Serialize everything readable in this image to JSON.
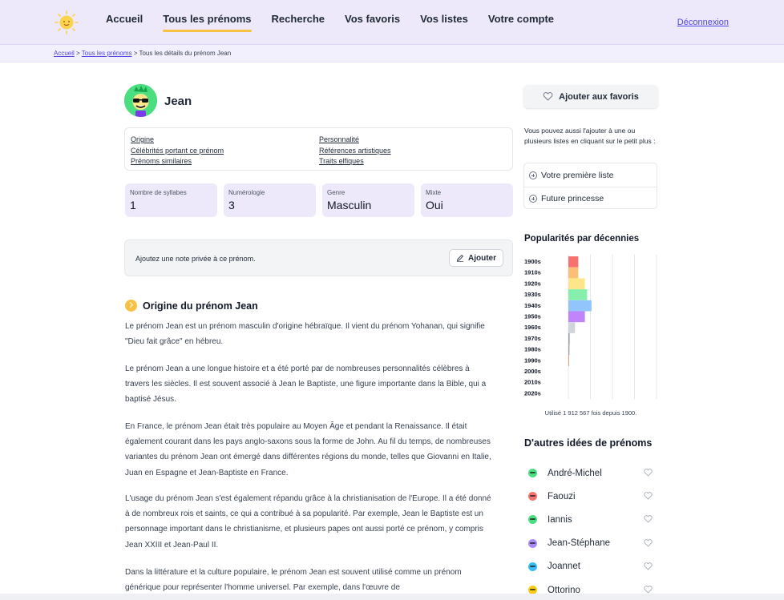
{
  "nav": {
    "items": [
      "Accueil",
      "Tous les prénoms",
      "Recherche",
      "Vos favoris",
      "Vos listes",
      "Votre compte"
    ],
    "active_index": 1,
    "logout": "Déconnexion",
    "logo_icon": "sun-icon"
  },
  "breadcrumb": {
    "home": "Accueil",
    "sep1": " > ",
    "all_names": "Tous les prénoms",
    "sep2": " > ",
    "current": "Tous les détails du prénom Jean"
  },
  "profile": {
    "name": "Jean",
    "avatar_icon": "sunglasses-avatar-icon",
    "avatar_color": "#4ade80"
  },
  "sections": {
    "left": [
      "Origine",
      "Célébrités portant ce prénom",
      "Prénoms similaires"
    ],
    "right": [
      "Personnalité",
      "Références artistiques",
      "Traits elfiques"
    ]
  },
  "stats": [
    {
      "label": "Nombre de syllabes",
      "value": "1"
    },
    {
      "label": "Numérologie",
      "value": "3"
    },
    {
      "label": "Genre",
      "value": "Masculin"
    },
    {
      "label": "Mixte",
      "value": "Oui"
    }
  ],
  "note": {
    "text": "Ajoutez une note privée à ce prénom.",
    "button": "Ajouter"
  },
  "origin": {
    "title": "Origine du prénom Jean",
    "paragraphs": [
      "Le prénom Jean est un prénom masculin d'origine hébraïque. Il vient du prénom Yohanan, qui signifie \"Dieu fait grâce\" en hébreu.",
      "Le prénom Jean a une longue histoire et a été porté par de nombreuses personnalités célèbres à travers les siècles. Il est souvent associé à Jean le Baptiste, une figure importante dans la Bible, qui a baptisé Jésus.",
      "En France, le prénom Jean était très populaire au Moyen Âge et pendant la Renaissance. Il était également courant dans les pays anglo-saxons sous la forme de John. Au fil du temps, de nombreuses variantes du prénom Jean ont émergé dans différentes régions du monde, telles que Giovanni en Italie, Juan en Espagne et Jean-Baptiste en France.",
      "L'usage du prénom Jean s'est également répandu grâce à la christianisation de l'Europe. Il a été donné à de nombreux rois et saints, ce qui a contribué à sa popularité. Par exemple, Jean le Baptiste est un personnage important dans le christianisme, et plusieurs papes ont aussi porté ce prénom, y compris Jean XXIII et Jean-Paul II.",
      "Dans la littérature et la culture populaire, le prénom Jean est souvent utilisé comme un prénom générique pour représenter l'homme universel. Par exemple, dans l'œuvre de"
    ]
  },
  "favorites": {
    "button": "Ajouter aux favoris",
    "lists_intro": "Vous pouvez aussi l'ajouter à une ou plusieurs listes en cliquant sur le petit plus :",
    "lists": [
      "Votre première liste",
      "Future princesse"
    ]
  },
  "popularity": {
    "title": "Popularités par décennies",
    "caption": "Utilisé 1 912 567 fois depuis 1900."
  },
  "chart_data": {
    "type": "bar",
    "orientation": "horizontal",
    "categories": [
      "1900s",
      "1910s",
      "1920s",
      "1930s",
      "1940s",
      "1950s",
      "1960s",
      "1970s",
      "1980s",
      "1990s",
      "2000s",
      "2010s",
      "2020s"
    ],
    "values": [
      9,
      9,
      15,
      17,
      21,
      15,
      6,
      1.2,
      1.0,
      0.6,
      0,
      0,
      0
    ],
    "colors": [
      "#f87171",
      "#fbbf77",
      "#fde68a",
      "#86efac",
      "#93c5fd",
      "#c084fc",
      "#d1d5db",
      "#9ca3af",
      "#9ca3af",
      "#e5a07a",
      "#9ca3af",
      "#9ca3af",
      "#9ca3af"
    ],
    "grid": true
  },
  "ideas": {
    "title": "D'autres idées de prénoms",
    "items": [
      {
        "name": "André-Michel",
        "color": "#4ade80"
      },
      {
        "name": "Faouzi",
        "color": "#f87171"
      },
      {
        "name": "Iannis",
        "color": "#4ade80"
      },
      {
        "name": "Jean-Stéphane",
        "color": "#a78bfa"
      },
      {
        "name": "Joannet",
        "color": "#38bdf8"
      },
      {
        "name": "Ottorino",
        "color": "#facc15"
      }
    ]
  }
}
